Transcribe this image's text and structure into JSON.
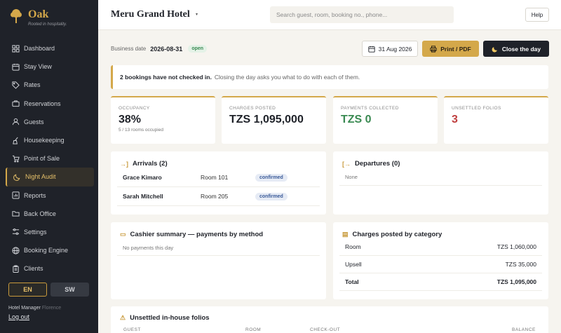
{
  "brand": {
    "name": "Oak",
    "tagline": "Rooted in hospitality."
  },
  "sidebar": {
    "items": [
      {
        "label": "Dashboard",
        "icon": "grid-icon",
        "active": false
      },
      {
        "label": "Stay View",
        "icon": "calendar-icon",
        "active": false
      },
      {
        "label": "Rates",
        "icon": "tag-icon",
        "active": false
      },
      {
        "label": "Reservations",
        "icon": "briefcase-icon",
        "active": false
      },
      {
        "label": "Guests",
        "icon": "user-icon",
        "active": false
      },
      {
        "label": "Housekeeping",
        "icon": "broom-icon",
        "active": false
      },
      {
        "label": "Point of Sale",
        "icon": "cart-icon",
        "active": false
      },
      {
        "label": "Night Audit",
        "icon": "moon-icon",
        "active": true
      },
      {
        "label": "Reports",
        "icon": "chart-icon",
        "active": false
      },
      {
        "label": "Back Office",
        "icon": "folder-icon",
        "active": false
      },
      {
        "label": "Settings",
        "icon": "sliders-icon",
        "active": false
      },
      {
        "label": "Booking Engine",
        "icon": "globe-icon",
        "active": false
      },
      {
        "label": "Clients",
        "icon": "clipboard-icon",
        "active": false
      }
    ],
    "lang": {
      "en": "EN",
      "sw": "SW"
    },
    "user_role": "Hotel Manager",
    "user_name": "Florence",
    "logout": "Log out"
  },
  "header": {
    "hotel_name": "Meru Grand Hotel",
    "search_placeholder": "Search guest, room, booking no., phone...",
    "help": "Help"
  },
  "toolbar": {
    "business_date_label": "Business date",
    "business_date": "2026-08-31",
    "status": "open",
    "date_button": "31 Aug 2026",
    "print_button": "Print / PDF",
    "close_button": "Close the day"
  },
  "alert": {
    "bold": "2 bookings have not checked in.",
    "text": "Closing the day asks you what to do with each of them."
  },
  "stats": {
    "occupancy": {
      "label": "OCCUPANCY",
      "value": "38%",
      "sub": "5 / 13 rooms occupied"
    },
    "charges": {
      "label": "CHARGES POSTED",
      "value": "TZS 1,095,000"
    },
    "payments": {
      "label": "PAYMENTS COLLECTED",
      "value": "TZS 0"
    },
    "folios": {
      "label": "UNSETTLED FOLIOS",
      "value": "3"
    }
  },
  "arrivals": {
    "title": "Arrivals (2)",
    "rows": [
      {
        "guest": "Grace Kimaro",
        "room": "Room 101",
        "status": "confirmed"
      },
      {
        "guest": "Sarah Mitchell",
        "room": "Room 205",
        "status": "confirmed"
      }
    ]
  },
  "departures": {
    "title": "Departures (0)",
    "empty": "None"
  },
  "cashier": {
    "title": "Cashier summary — payments by method",
    "empty": "No payments this day"
  },
  "charges_by_category": {
    "title": "Charges posted by category",
    "rows": [
      {
        "category": "Room",
        "amount": "TZS 1,060,000"
      },
      {
        "category": "Upsell",
        "amount": "TZS 35,000"
      },
      {
        "category": "Total",
        "amount": "TZS 1,095,000"
      }
    ]
  },
  "folios": {
    "title": "Unsettled in-house folios",
    "columns": [
      "GUEST",
      "ROOM",
      "CHECK-OUT",
      "BALANCE"
    ]
  },
  "colors": {
    "accent": "#d4a84a",
    "sidebar": "#1f2229",
    "positive": "#3a8a52",
    "negative": "#c04040"
  }
}
